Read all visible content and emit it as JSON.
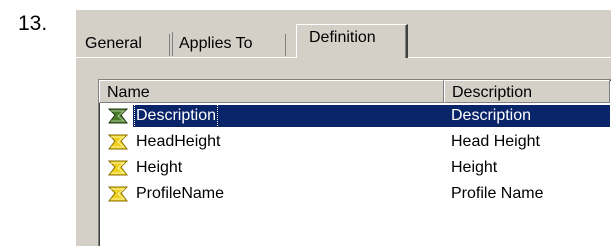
{
  "step": {
    "number": "13."
  },
  "tabs": [
    {
      "label": "General"
    },
    {
      "label": "Applies To"
    },
    {
      "label": "Definition"
    }
  ],
  "list": {
    "columns": [
      "Name",
      "Description"
    ],
    "rows": [
      {
        "name": "Description",
        "description": "Description",
        "icon": "parameter-icon",
        "selected": true
      },
      {
        "name": "HeadHeight",
        "description": "Head Height",
        "icon": "parameter-icon",
        "selected": false
      },
      {
        "name": "Height",
        "description": "Height",
        "icon": "parameter-icon",
        "selected": false
      },
      {
        "name": "ProfileName",
        "description": "Profile Name",
        "icon": "parameter-icon",
        "selected": false
      }
    ]
  },
  "colors": {
    "selection": "#0a246a",
    "dialog_bg": "#d4d0c8",
    "icon_fill": "#f0d020",
    "icon_selected_fill": "#4a7a2a"
  }
}
